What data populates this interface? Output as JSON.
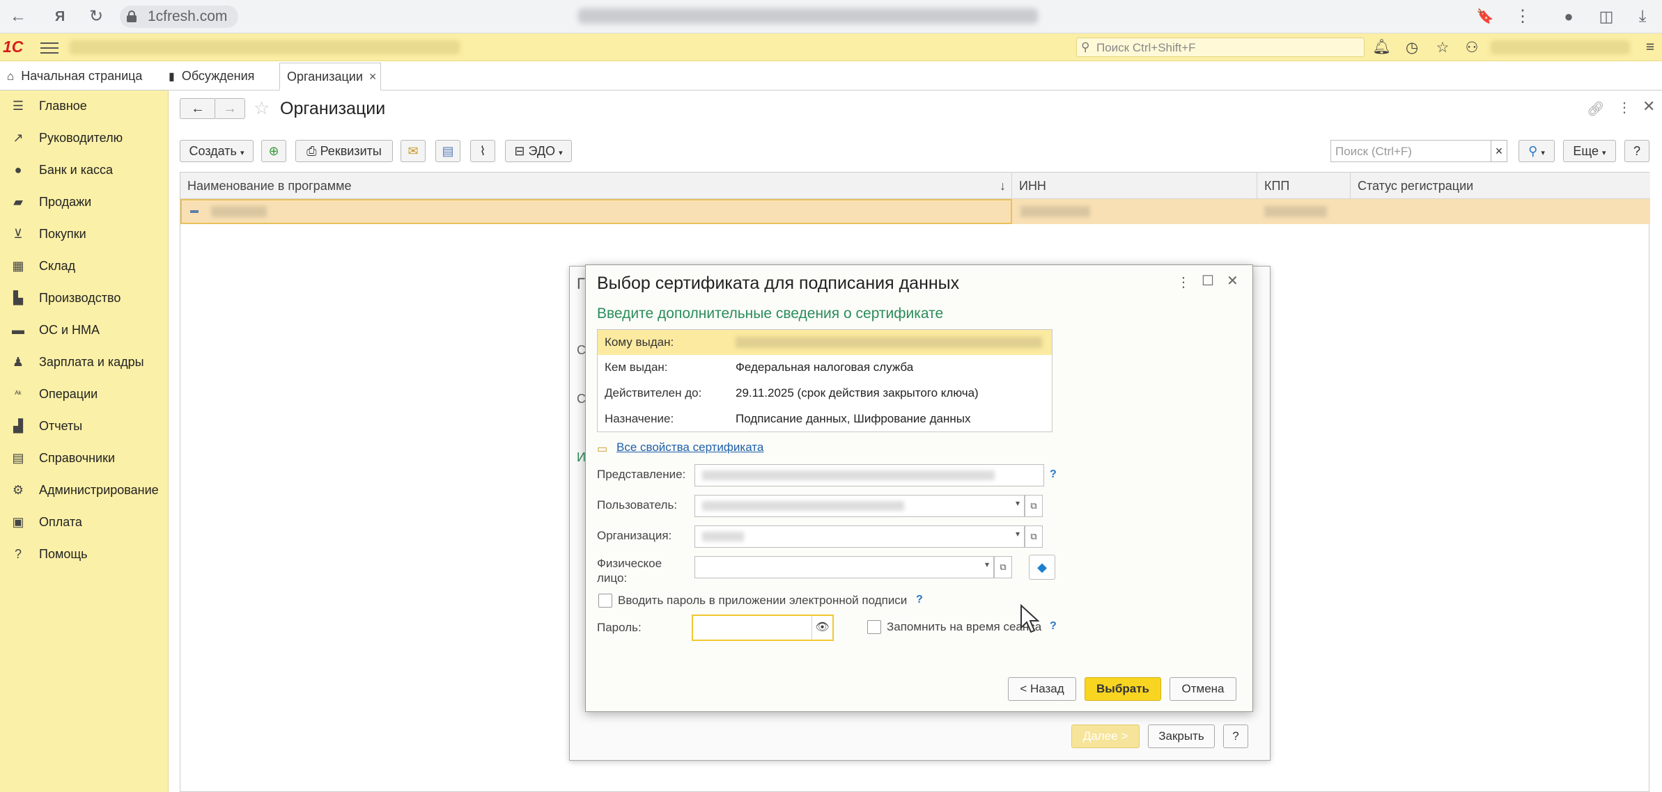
{
  "browser": {
    "url": "1cfresh.com"
  },
  "topbar": {
    "logo": "1С",
    "search_placeholder": "Поиск Ctrl+Shift+F"
  },
  "tabs": [
    {
      "label": "Начальная страница"
    },
    {
      "label": "Обсуждения"
    },
    {
      "label": "Организации",
      "close": "×"
    }
  ],
  "sidebar": {
    "items": [
      {
        "label": "Главное",
        "icon": "list-icon"
      },
      {
        "label": "Руководителю",
        "icon": "trend-icon"
      },
      {
        "label": "Банк и касса",
        "icon": "coin-icon"
      },
      {
        "label": "Продажи",
        "icon": "bag-icon"
      },
      {
        "label": "Покупки",
        "icon": "cart-icon"
      },
      {
        "label": "Склад",
        "icon": "grid-icon"
      },
      {
        "label": "Производство",
        "icon": "factory-icon"
      },
      {
        "label": "ОС и НМА",
        "icon": "truck-icon"
      },
      {
        "label": "Зарплата и кадры",
        "icon": "person-icon"
      },
      {
        "label": "Операции",
        "icon": "operations-icon"
      },
      {
        "label": "Отчеты",
        "icon": "bar-chart-icon"
      },
      {
        "label": "Справочники",
        "icon": "book-icon"
      },
      {
        "label": "Администрирование",
        "icon": "gear-icon"
      },
      {
        "label": "Оплата",
        "icon": "wallet-icon"
      },
      {
        "label": "Помощь",
        "icon": "question-icon"
      }
    ]
  },
  "page": {
    "title": "Организации"
  },
  "toolbar": {
    "create": "Создать",
    "requisites": "Реквизиты",
    "edo": "ЭДО",
    "search_placeholder": "Поиск (Ctrl+F)",
    "clear": "×",
    "more": "Еще",
    "help": "?"
  },
  "grid": {
    "columns": [
      "Наименование в программе",
      "ИНН",
      "КПП",
      "Статус регистрации"
    ],
    "sort_indicator": "↓"
  },
  "back_dialog": {
    "next": "Далее >",
    "close": "Закрыть",
    "help": "?"
  },
  "dialog": {
    "title": "Выбор сертификата для подписания данных",
    "subtitle": "Введите дополнительные сведения о сертификате",
    "cert": [
      {
        "key": "Кому выдан:",
        "value": ""
      },
      {
        "key": "Кем выдан:",
        "value": "Федеральная налоговая служба"
      },
      {
        "key": "Действителен до:",
        "value": "29.11.2025 (срок действия закрытого ключа)"
      },
      {
        "key": "Назначение:",
        "value": "Подписание данных, Шифрование данных"
      }
    ],
    "all_props_link": "Все свойства сертификата",
    "labels": {
      "representation": "Представление:",
      "user": "Пользователь:",
      "organization": "Организация:",
      "individual_line1": "Физическое",
      "individual_line2": "лицо:",
      "enter_password_app": "Вводить пароль в приложении электронной подписи",
      "password": "Пароль:",
      "remember": "Запомнить на время сеанса"
    },
    "help": "?",
    "buttons": {
      "back": "< Назад",
      "select": "Выбрать",
      "cancel": "Отмена"
    }
  }
}
